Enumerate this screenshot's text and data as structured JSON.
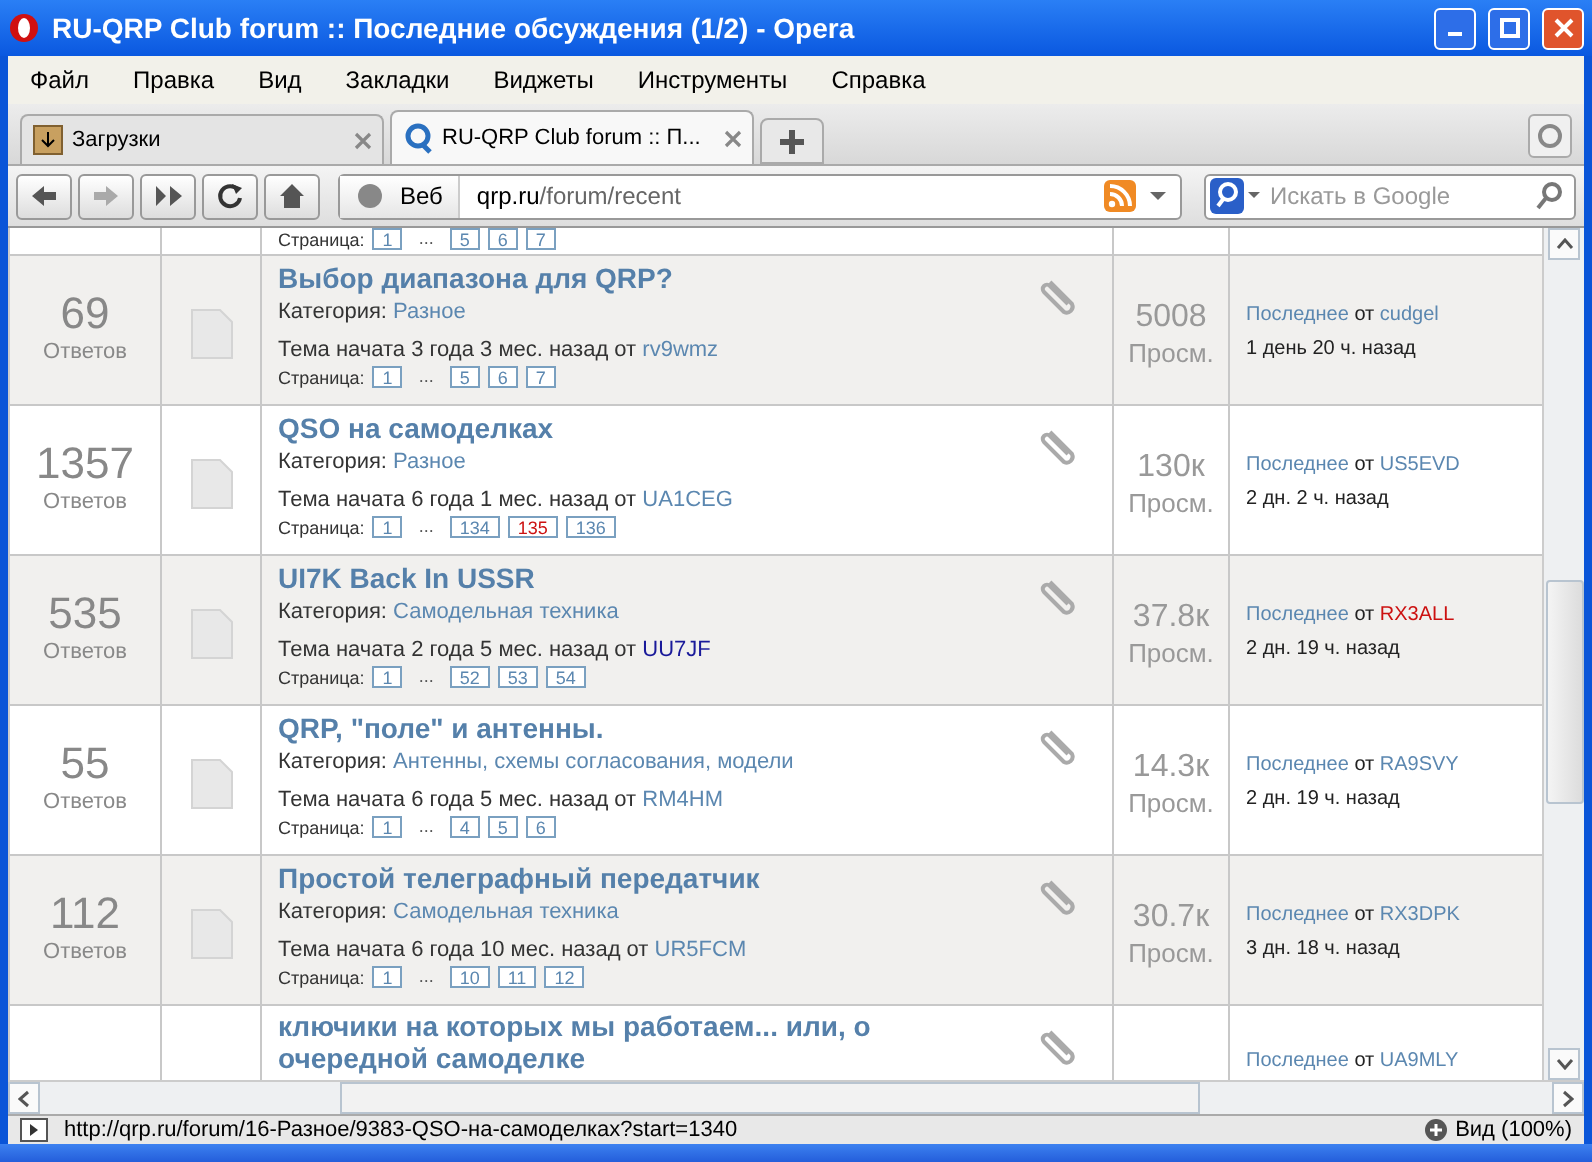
{
  "window": {
    "title": "RU-QRP Club forum :: Последние обсуждения (1/2) - Opera"
  },
  "menu": [
    "Файл",
    "Правка",
    "Вид",
    "Закладки",
    "Виджеты",
    "Инструменты",
    "Справка"
  ],
  "tabs": [
    {
      "label": "Загрузки",
      "selected": false
    },
    {
      "label": "RU-QRP Club forum :: П...",
      "selected": true
    }
  ],
  "address": {
    "scope": "Веб",
    "host": "qrp.ru",
    "path": "/forum/recent",
    "search_placeholder": "Искать в Google"
  },
  "top_row": {
    "pages_label": "Страница:",
    "pages": [
      {
        "label": "1",
        "selected": false
      },
      {
        "label": "...",
        "selected": false
      },
      {
        "label": "5",
        "selected": false
      },
      {
        "label": "6",
        "selected": false
      },
      {
        "label": "7",
        "selected": false
      }
    ]
  },
  "topics": [
    {
      "replies": "69",
      "replies_label": "Ответов",
      "title": "Выбор диапазона для QRP?",
      "category_label": "Категория:",
      "category": "Разное",
      "started": "Тема начата 3 года 3 мес. назад от",
      "author": {
        "name": "rv9wmz",
        "color": "#5b87b0"
      },
      "pages_label": "Страница:",
      "pages": [
        {
          "label": "1",
          "selected": false
        },
        {
          "label": "...",
          "selected": false
        },
        {
          "label": "5",
          "selected": false
        },
        {
          "label": "6",
          "selected": false
        },
        {
          "label": "7",
          "selected": false
        }
      ],
      "views": "5008",
      "views_label": "Просм.",
      "last_label": "Последнее",
      "last_from": "от",
      "last_author": {
        "name": "cudgel",
        "color": "#5b87b0"
      },
      "last_time": "1 день 20 ч. назад"
    },
    {
      "replies": "1357",
      "replies_label": "Ответов",
      "title": "QSO на самоделках",
      "category_label": "Категория:",
      "category": "Разное",
      "started": "Тема начата 6 года 1 мес. назад от",
      "author": {
        "name": "UA1CEG",
        "color": "#5b87b0"
      },
      "pages_label": "Страница:",
      "pages": [
        {
          "label": "1",
          "selected": false
        },
        {
          "label": "...",
          "selected": false
        },
        {
          "label": "134",
          "selected": false
        },
        {
          "label": "135",
          "selected": true
        },
        {
          "label": "136",
          "selected": false
        }
      ],
      "views": "130к",
      "views_label": "Просм.",
      "last_label": "Последнее",
      "last_from": "от",
      "last_author": {
        "name": "US5EVD",
        "color": "#5b87b0"
      },
      "last_time": "2 дн. 2 ч. назад"
    },
    {
      "replies": "535",
      "replies_label": "Ответов",
      "title": "UI7K Back In USSR",
      "category_label": "Категория:",
      "category": "Самодельная техника",
      "started": "Тема начата 2 года 5 мес. назад от",
      "author": {
        "name": "UU7JF",
        "color": "#1a1a9a"
      },
      "pages_label": "Страница:",
      "pages": [
        {
          "label": "1",
          "selected": false
        },
        {
          "label": "...",
          "selected": false
        },
        {
          "label": "52",
          "selected": false
        },
        {
          "label": "53",
          "selected": false
        },
        {
          "label": "54",
          "selected": false
        }
      ],
      "views": "37.8к",
      "views_label": "Просм.",
      "last_label": "Последнее",
      "last_from": "от",
      "last_author": {
        "name": "RX3ALL",
        "color": "#cc1111"
      },
      "last_time": "2 дн. 19 ч. назад"
    },
    {
      "replies": "55",
      "replies_label": "Ответов",
      "title": "QRP, \"поле\" и антенны.",
      "category_label": "Категория:",
      "category": "Антенны, схемы согласования, модели",
      "started": "Тема начата 6 года 5 мес. назад от",
      "author": {
        "name": "RM4HM",
        "color": "#5b87b0"
      },
      "pages_label": "Страница:",
      "pages": [
        {
          "label": "1",
          "selected": false
        },
        {
          "label": "...",
          "selected": false
        },
        {
          "label": "4",
          "selected": false
        },
        {
          "label": "5",
          "selected": false
        },
        {
          "label": "6",
          "selected": false
        }
      ],
      "views": "14.3к",
      "views_label": "Просм.",
      "last_label": "Последнее",
      "last_from": "от",
      "last_author": {
        "name": "RA9SVY",
        "color": "#5b87b0"
      },
      "last_time": "2 дн. 19 ч. назад"
    },
    {
      "replies": "112",
      "replies_label": "Ответов",
      "title": "Простой телеграфный передатчик",
      "category_label": "Категория:",
      "category": "Самодельная техника",
      "started": "Тема начата 6 года 10 мес. назад от",
      "author": {
        "name": "UR5FCM",
        "color": "#5b87b0"
      },
      "pages_label": "Страница:",
      "pages": [
        {
          "label": "1",
          "selected": false
        },
        {
          "label": "...",
          "selected": false
        },
        {
          "label": "10",
          "selected": false
        },
        {
          "label": "11",
          "selected": false
        },
        {
          "label": "12",
          "selected": false
        }
      ],
      "views": "30.7к",
      "views_label": "Просм.",
      "last_label": "Последнее",
      "last_from": "от",
      "last_author": {
        "name": "RX3DPK",
        "color": "#5b87b0"
      },
      "last_time": "3 дн. 18 ч. назад"
    },
    {
      "title": "ключики на которых мы работаем... или, о очередной самоделке",
      "last_label": "Последнее",
      "last_from": "от",
      "last_author": {
        "name": "UA9MLY",
        "color": "#5b87b0"
      }
    }
  ],
  "status_bar": {
    "url": "http://qrp.ru/forum/16-Разное/9383-QSO-на-самоделках?start=1340",
    "zoom": "Вид (100%)"
  }
}
